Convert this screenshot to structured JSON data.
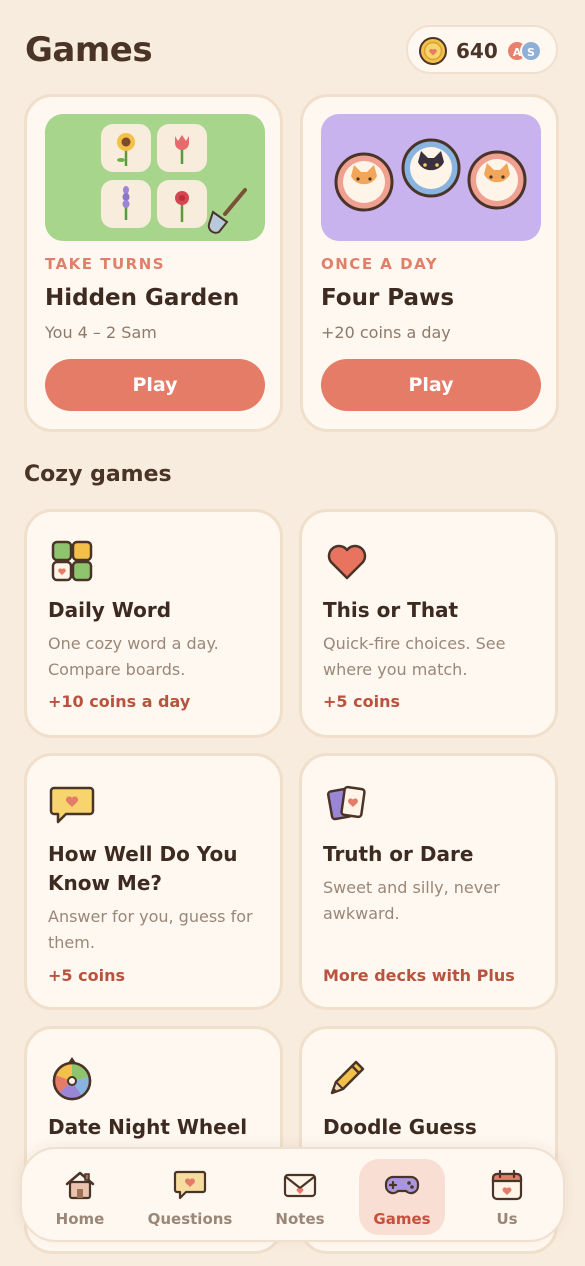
{
  "header": {
    "title": "Games",
    "coins": "640",
    "avatars": [
      "A",
      "S"
    ]
  },
  "featured": [
    {
      "tag": "TAKE TURNS",
      "title": "Hidden Garden",
      "subtitle": "You 4 – 2 Sam",
      "play_label": "Play",
      "art": "garden-tiles-and-shovel",
      "art_bg": "#a8d58c"
    },
    {
      "tag": "ONCE A DAY",
      "title": "Four Paws",
      "subtitle": "+20 coins a day",
      "play_label": "Play",
      "art": "three-cat-tokens",
      "art_bg": "#c9b3ee"
    }
  ],
  "section": {
    "title": "Cozy games"
  },
  "games": [
    {
      "icon": "tile-grid-icon",
      "title": "Daily Word",
      "description": "One cozy word a day. Compare boards.",
      "reward": "+10 coins a day"
    },
    {
      "icon": "heart-icon",
      "title": "This or That",
      "description": "Quick-fire choices. See where you match.",
      "reward": "+5 coins"
    },
    {
      "icon": "speech-heart-icon",
      "title": "How Well Do You Know Me?",
      "description": "Answer for you, guess for them.",
      "reward": "+5 coins"
    },
    {
      "icon": "cards-icon",
      "title": "Truth or Dare",
      "description": "Sweet and silly, never awkward.",
      "reward": "More decks with Plus"
    },
    {
      "icon": "color-wheel-icon",
      "title": "Date Night Wheel",
      "description": "",
      "reward": ""
    },
    {
      "icon": "pencil-icon",
      "title": "Doodle Guess",
      "description": "",
      "reward": ""
    }
  ],
  "tabs": [
    {
      "label": "Home",
      "icon": "house-icon",
      "active": false
    },
    {
      "label": "Questions",
      "icon": "speech-bubble-icon",
      "active": false
    },
    {
      "label": "Notes",
      "icon": "envelope-icon",
      "active": false
    },
    {
      "label": "Games",
      "icon": "gamepad-icon",
      "active": true
    },
    {
      "label": "Us",
      "icon": "calendar-heart-icon",
      "active": false
    }
  ],
  "colors": {
    "background": "#f8ecdf",
    "card": "#fff8f0",
    "accent": "#e57c68",
    "reward_text": "#b9533f",
    "active_tab_bg": "#f9dfd3"
  }
}
